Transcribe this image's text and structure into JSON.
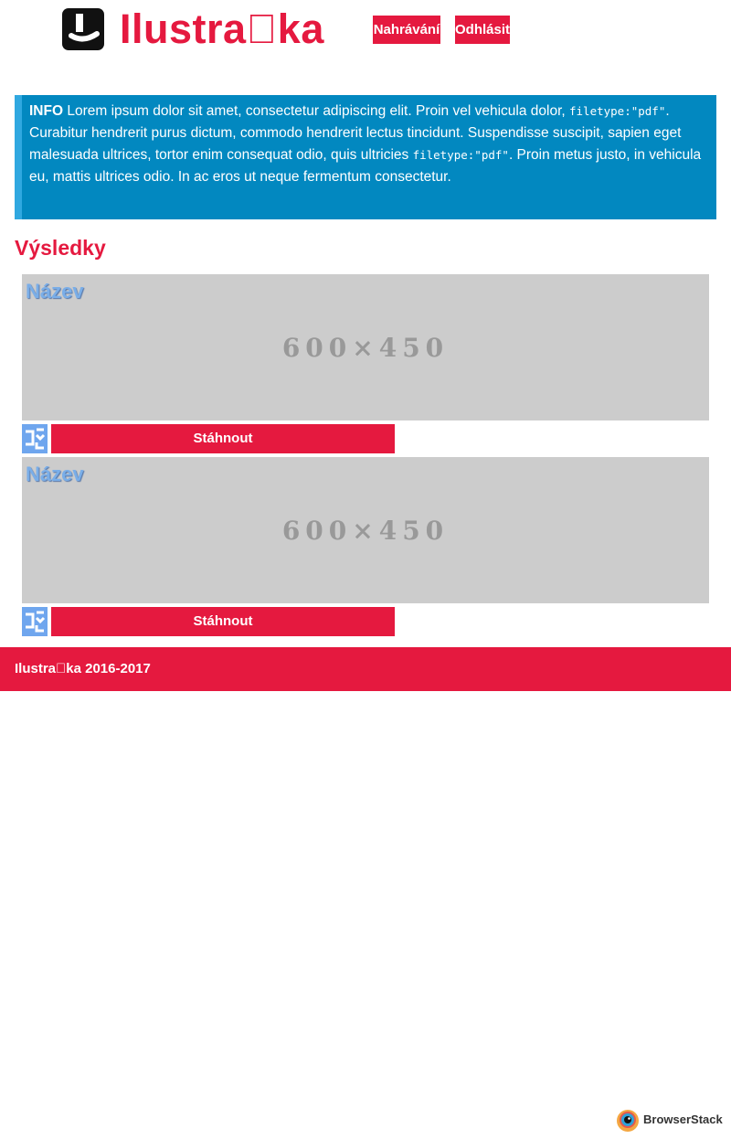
{
  "header": {
    "brand": "Ilustra\u0000ka",
    "nav": {
      "upload": "Nahrávání",
      "logout": "Odhlásit"
    }
  },
  "info": {
    "label": "INFO",
    "text1": " Lorem ipsum dolor sit amet, consectetur adipiscing elit. Proin vel vehicula dolor, ",
    "code1": "filetype:\"pdf\"",
    "text2": ". Curabitur hendrerit purus dictum, commodo hendrerit lectus tincidunt. Suspendisse suscipit, sapien eget malesuada ultrices, tortor enim consequat odio, quis ultricies ",
    "code2": "filetype:\"pdf\"",
    "text3": ". Proin metus justo, in vehicula eu, mattis ultrices odio. In ac eros ut neque fermentum consectetur."
  },
  "results": {
    "title": "Výsledky",
    "items": [
      {
        "name": "Název",
        "placeholder": "600×450",
        "download": "Stáhnout"
      },
      {
        "name": "Název",
        "placeholder": "600×450",
        "download": "Stáhnout"
      }
    ]
  },
  "footer": {
    "text": "Ilustra\u0000ka 2016-2017"
  },
  "branding": {
    "browserstack": "BrowserStack"
  },
  "colors": {
    "accent": "#e5193f",
    "info": "#0288c0",
    "placeholder": "#cccccc"
  },
  "icons": {
    "logo": "e-logo-icon",
    "download": "download-icon"
  }
}
